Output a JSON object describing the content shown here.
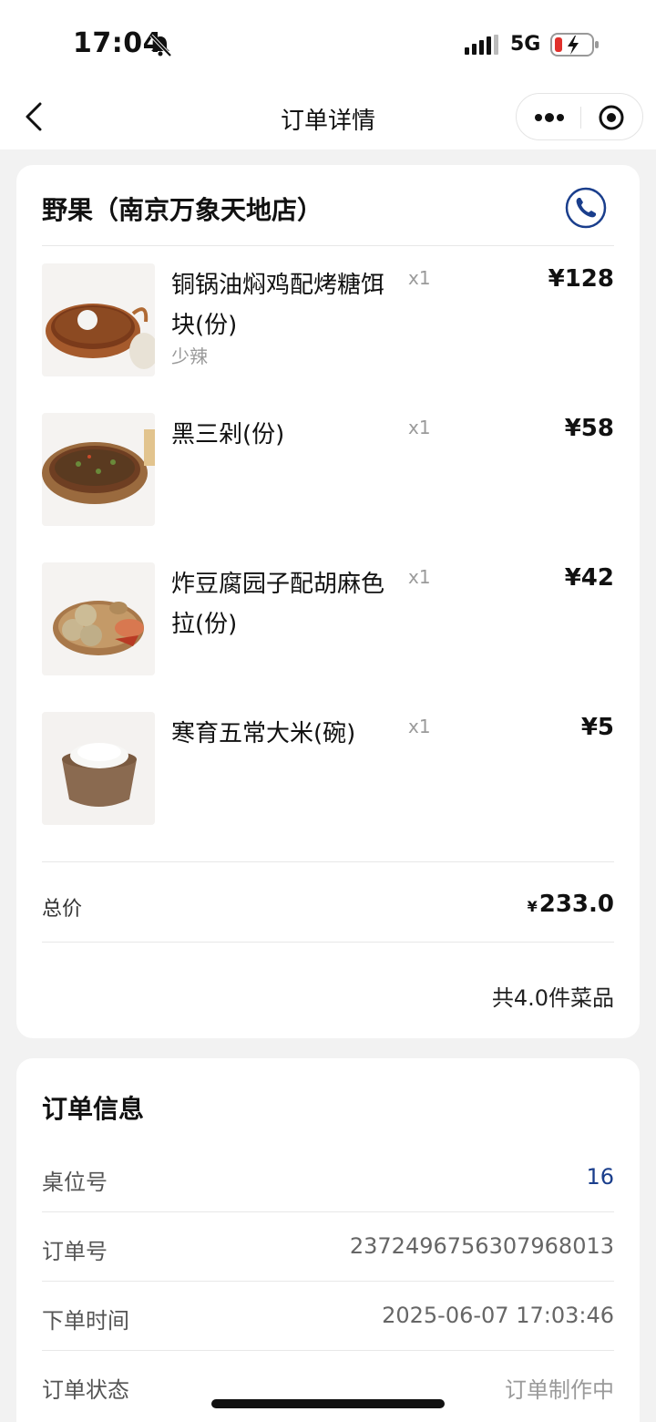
{
  "status_bar": {
    "time": "17:04",
    "network": "5G"
  },
  "nav": {
    "title": "订单详情"
  },
  "store": {
    "name": "野果（南京万象天地店）",
    "items": [
      {
        "name": "铜锅油焖鸡配烤糖饵块(份)",
        "note": "少辣",
        "qty": "x1",
        "price": "¥128"
      },
      {
        "name": "黑三剁(份)",
        "note": "",
        "qty": "x1",
        "price": "¥58"
      },
      {
        "name": "炸豆腐园子配胡麻色拉(份)",
        "note": "",
        "qty": "x1",
        "price": "¥42"
      },
      {
        "name": "寒育五常大米(碗)",
        "note": "",
        "qty": "x1",
        "price": "¥5"
      }
    ],
    "total_label": "总价",
    "total_currency": "¥",
    "total_value": "233.0",
    "count_text": "共4.0件菜品"
  },
  "order_info": {
    "title": "订单信息",
    "rows": [
      {
        "label": "桌位号",
        "value": "16"
      },
      {
        "label": "订单号",
        "value": "2372496756307968013"
      },
      {
        "label": "下单时间",
        "value": "2025-06-07 17:03:46"
      },
      {
        "label": "订单状态",
        "value": "订单制作中"
      }
    ]
  },
  "colors": {
    "accent": "#1a3e8c",
    "background": "#f2f2f2",
    "muted": "#9a9a9a"
  }
}
